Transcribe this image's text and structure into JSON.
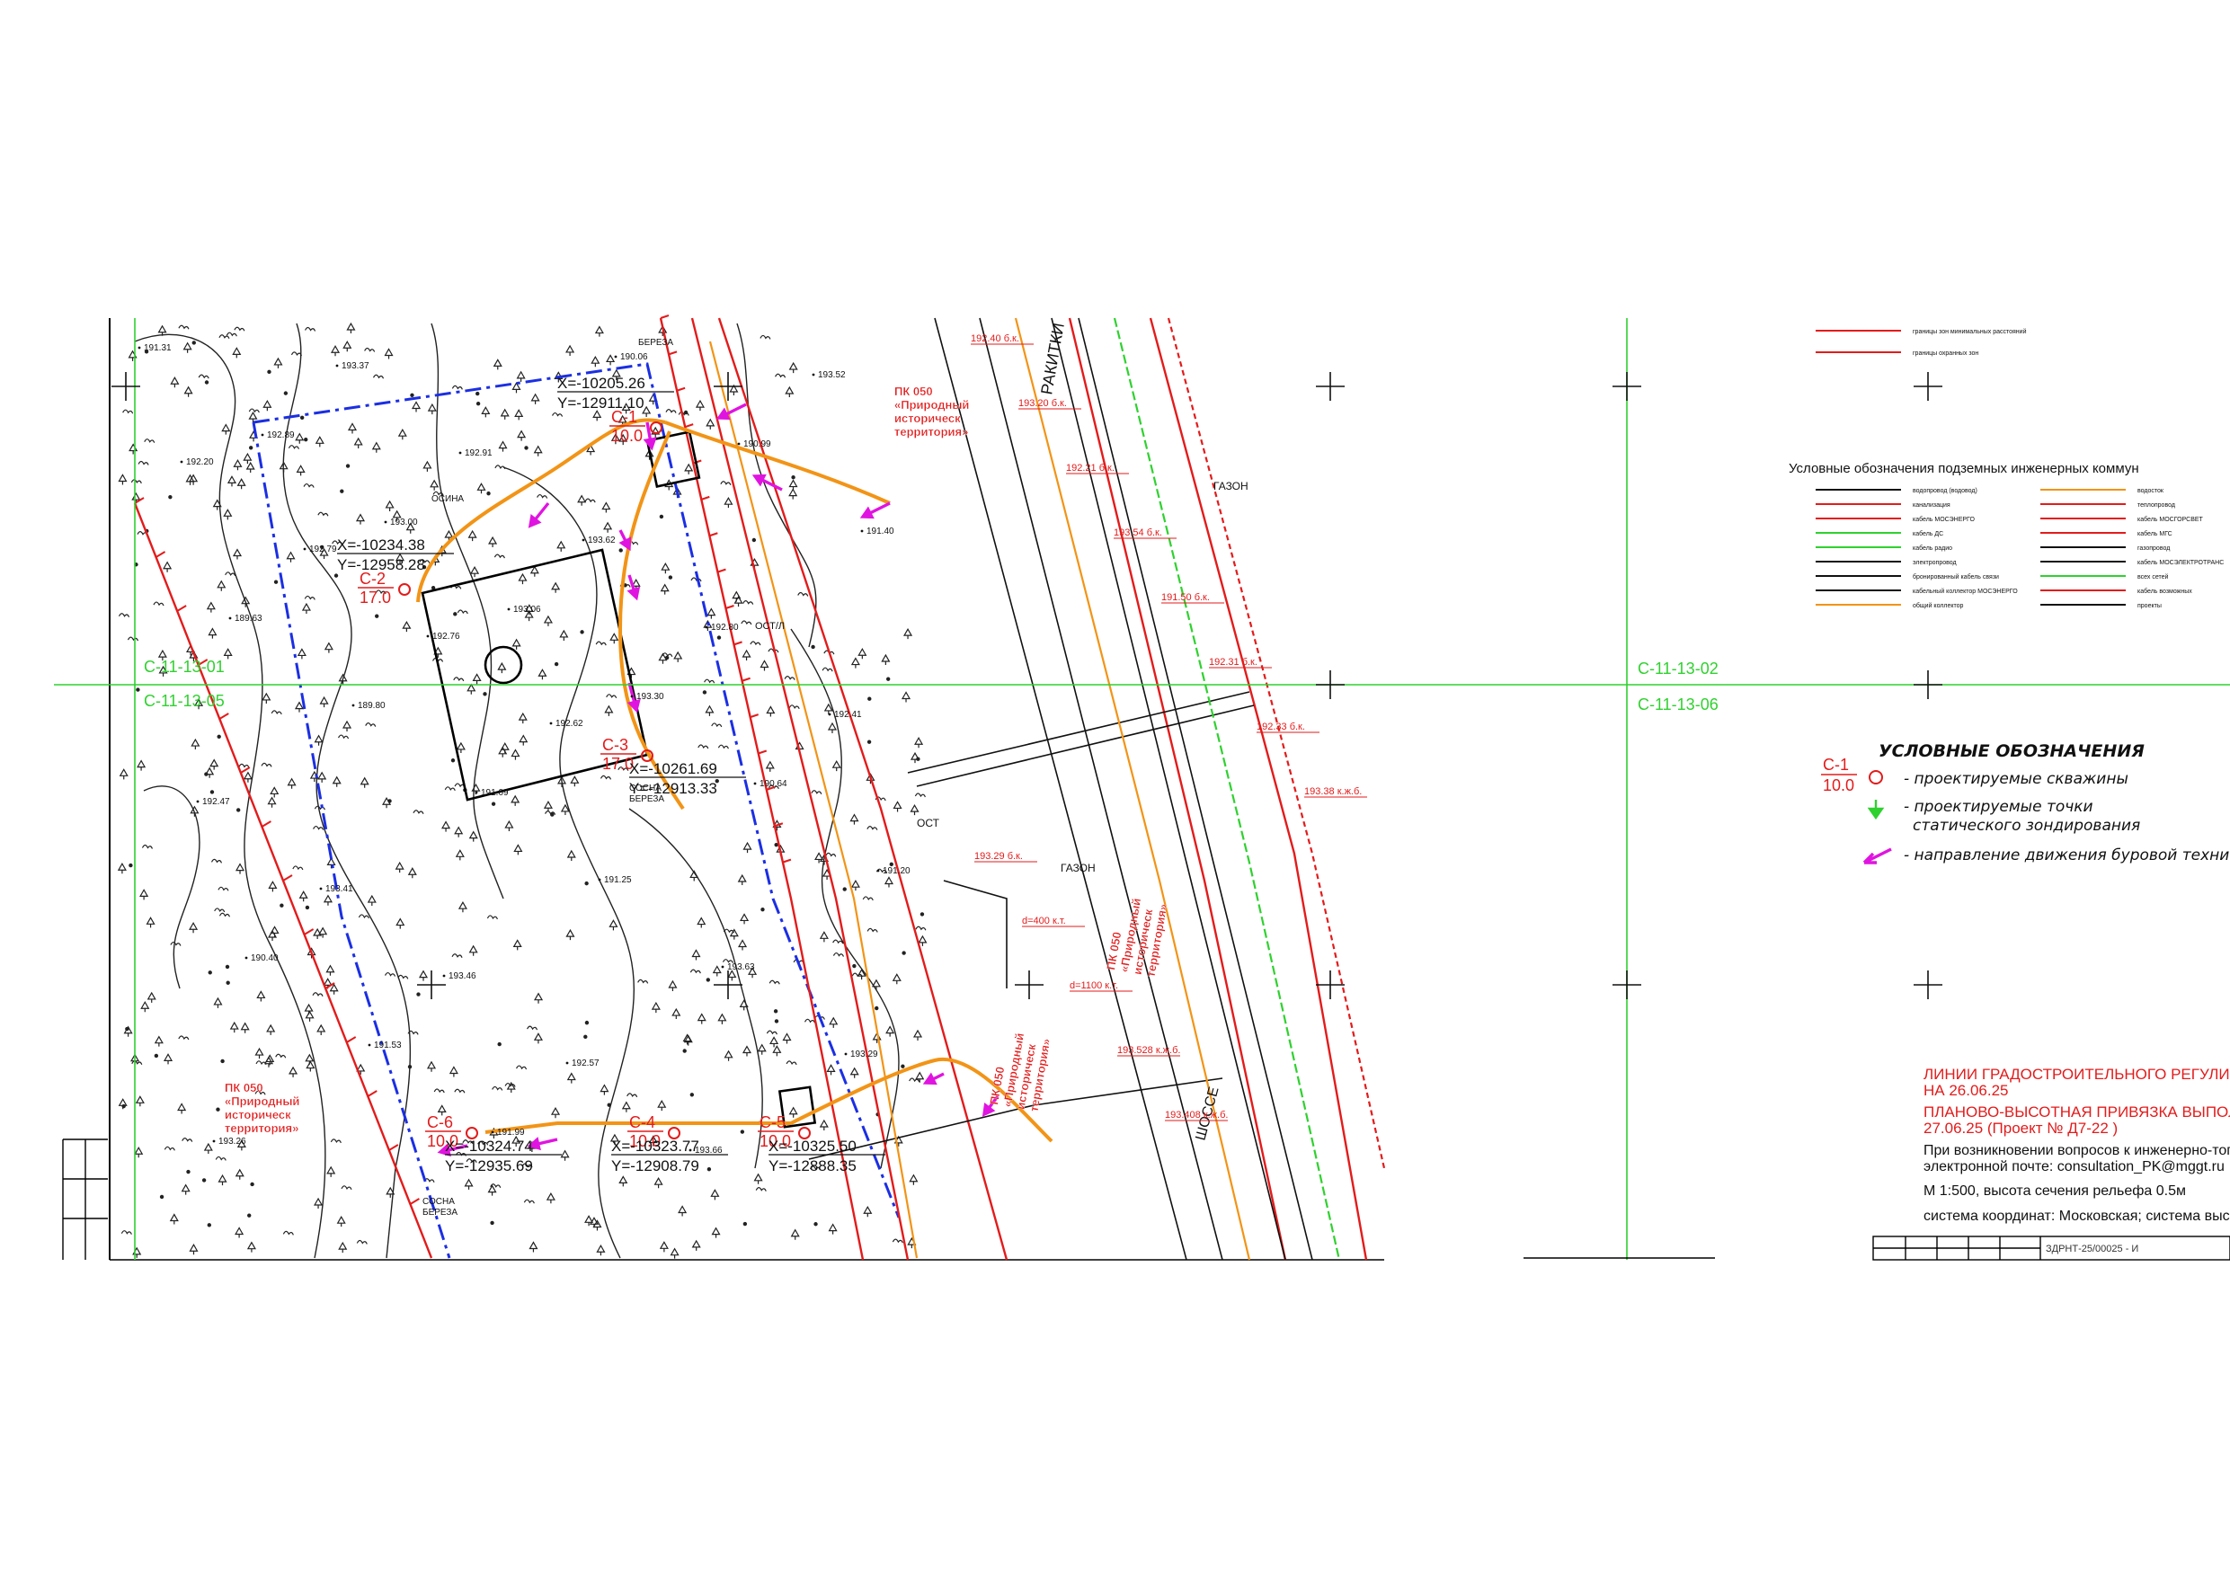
{
  "map": {
    "sheet_left": "С-11-13-01",
    "sheet_left_below": "С-11-13-05",
    "sheet_right": "С-11-13-02",
    "sheet_right_below": "С-11-13-06",
    "street": "РАКИТКИ",
    "road": "ШОССЕ",
    "lawn": "ГАЗОН",
    "trees": [
      "ОСИНА",
      "БЕРЕЗА",
      "СОСНА",
      "БЕРЕЗА",
      "СОСНА",
      "БЕРЕЗА"
    ],
    "stop": "ОСТ",
    "station": "ОСТ/Л"
  },
  "boreholes": [
    {
      "id": "С-1",
      "depth": "10.0",
      "x": "X=-10205.26",
      "y": "Y=-12911.10"
    },
    {
      "id": "С-2",
      "depth": "17.0",
      "x": "X=-10234.38",
      "y": "Y=-12958.28"
    },
    {
      "id": "С-3",
      "depth": "17.0",
      "x": "X=-10261.69",
      "y": "Y=-12913.33"
    },
    {
      "id": "С-4",
      "depth": "10.0",
      "x": "X=-10323.77",
      "y": "Y=-12908.79"
    },
    {
      "id": "С-5",
      "depth": "10.0",
      "x": "X=-10325.50",
      "y": "Y=-12888.35"
    },
    {
      "id": "С-6",
      "depth": "10.0",
      "x": "X=-10324.74",
      "y": "Y=-12935.69"
    }
  ],
  "protected_zone": [
    "ПК 050",
    "«Природный",
    "историческ",
    "территория»"
  ],
  "elevations": [
    "191.31",
    "192.89",
    "193.00",
    "193.06",
    "193.30",
    "190.64",
    "191.20",
    "190.40",
    "191.53",
    "191.99",
    "190.06",
    "190.99",
    "191.40",
    "189.63",
    "189.80",
    "191.09",
    "191.25",
    "193.63",
    "193.29",
    "193.26",
    "193.37",
    "192.91",
    "193.62",
    "192.80",
    "192.41",
    "192.47",
    "193.41",
    "193.46",
    "192.57",
    "193.66",
    "193.52",
    "192.20",
    "192.79",
    "192.76",
    "192.62"
  ],
  "utilities": [
    "192.40 б.к.",
    "193.20 б.к.",
    "192.21 б.к.",
    "193.54 б.к.",
    "191.50 б.к.",
    "192.31 б.к.",
    "192.33 б.к.",
    "193.38 к.ж.б.",
    "193.29 б.к.",
    "d=400 к.т.",
    "d=1100 к.т.",
    "193.528 к.ж.б.",
    "193.408 к.ж.б."
  ],
  "legend_top": {
    "title": "Условные обозначения подземных инженерных коммун",
    "rows": [
      "границы зон минимальных расстояний",
      "границы охранных зон",
      "водопровод (водовод)",
      "канализация",
      "кабель МОСЭНЕРГО",
      "кабель ДС",
      "кабель радио",
      "электропровод",
      "бронированный кабель связи",
      "кабельный коллектор МОСЭНЕРГО",
      "общий коллектор",
      "водосток",
      "теплопровод",
      "кабель МОСГОРСВЕТ",
      "кабель МГС",
      "газопровод",
      "кабель МОСЭЛЕКТРОТРАНС",
      "всех сетей",
      "кабель возможных",
      "проекты"
    ]
  },
  "legend": {
    "title": "УСЛОВНЫЕ ОБОЗНАЧЕНИЯ",
    "sample_id": "С-1",
    "sample_depth": "10.0",
    "item1": "- проектируемые скважины",
    "item2a": "- проектируемые точки",
    "item2b": "статического зондирования",
    "item3": "- направление движения буровой техники"
  },
  "notes": {
    "red1": "ЛИНИИ ГРАДОСТРОИТЕЛЬНОГО РЕГУЛИРОВАНИЯ НАНЕСЕ",
    "red1b": "НА 26.06.25",
    "red2": "ПЛАНОВО-ВЫСОТНАЯ ПРИВЯЗКА ВЫПОЛНЕНА ПО СОСТОЯ",
    "red2b": "27.06.25 (Проект № Д7-22 )",
    "line3": "При возникновении вопросов к инженерно-топографическому",
    "line4": "электронной почте: consultation_PK@mggt.ru",
    "scale": "М 1:500, высота сечения рельефа 0.5м",
    "system": "система координат: Московская; система высот: Московская"
  },
  "stamp": "ЗДРНТ-25/00025 - И",
  "colors": {
    "grid": "#2fd12f",
    "drill_path": "#f29416",
    "red_line": "#e31b1b",
    "blue_line": "#1b2fe3",
    "magenta_arrow": "#e014e0",
    "contour": "#111111"
  }
}
